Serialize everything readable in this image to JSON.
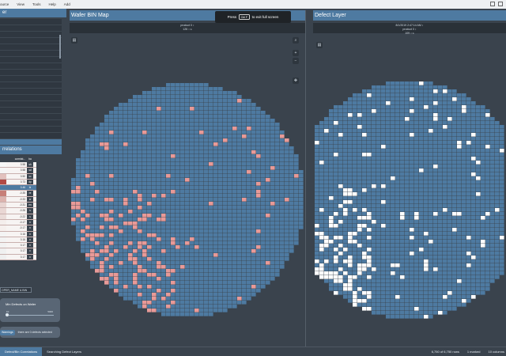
{
  "menubar": {
    "items": [
      "ource",
      "View",
      "Tools",
      "Help",
      "Add"
    ]
  },
  "left_panel": {
    "title_partial": "er",
    "param_rows": 20,
    "correlations_title_partial": "rrelations",
    "table": {
      "headers": [
        "",
        "correlat...",
        "ba"
      ],
      "rows": [
        {
          "value": "0.58",
          "bin": "sh",
          "color": "#f7f7f7"
        },
        {
          "value": "0.58",
          "bin": "sd",
          "color": "#f5f5f5"
        },
        {
          "value": "0.50",
          "bin": "sc",
          "color": "#e2c1bd"
        },
        {
          "value": "0.73",
          "bin": "dp",
          "color": "#b24a45"
        },
        {
          "value": "0.46",
          "bin": "bi",
          "color": "#4e7aa1",
          "selected": true
        },
        {
          "value": "-0.35",
          "bin": "re",
          "color": "#c77f78"
        },
        {
          "value": "-0.33",
          "bin": "w",
          "color": "#dcb3ae"
        },
        {
          "value": "-0.31",
          "bin": "en",
          "color": "#e8d4d1"
        },
        {
          "value": "-0.26",
          "bin": "s",
          "color": "#e9d7d4"
        },
        {
          "value": "-0.22",
          "bin": "s",
          "color": "#eadcd9"
        },
        {
          "value": "-0.17",
          "bin": "n",
          "color": "#f4eeec"
        },
        {
          "value": "-0.17",
          "bin": "n",
          "color": "#f6f0ee"
        },
        {
          "value": "0.16",
          "bin": "n",
          "color": "#f4f4f4"
        },
        {
          "value": "0.16",
          "bin": "n",
          "color": "#f3f3f3"
        },
        {
          "value": "0.17",
          "bin": "n",
          "color": "#f2f2f2"
        },
        {
          "value": "0.17",
          "bin": "c",
          "color": "#f0f0f0"
        },
        {
          "value": "0.17",
          "bin": "n",
          "color": "#efefef"
        }
      ]
    },
    "bin_filter_value": "OPER_NAME & BIN",
    "min_defects": {
      "label": "Min Defects on Wafer",
      "min": "10",
      "max": "5000",
      "level": 0.0
    },
    "warnings": {
      "button": "Warnings",
      "text": "there are 0 defects selected"
    }
  },
  "wbin_view": {
    "title": "Wafer BIN Map",
    "subbar_line1": "product 0 ↕",
    "subbar_line2": "126 ↕ ≤",
    "tools": [
      "search-icon",
      "zoom-in-icon",
      "zoom-out-icon",
      "pan-icon"
    ],
    "die_color": "#4e7aa1",
    "flag_color": "#e89a98",
    "grid_color": "#6d90b0"
  },
  "defect_view": {
    "title": "Defect Layer",
    "subbar_line1": "8/1/2019 2:47:14 AM ↕",
    "subbar_line2": "product 0 ↕",
    "subbar_line3": "109 ↕ ≤",
    "die_color": "#4e7aa1",
    "defect_color": "#ffffff"
  },
  "fullscreen_notice": {
    "press": "Press",
    "key": "Ctrl F",
    "rest": "to exit full screen"
  },
  "statusbar": {
    "tabs": [
      "Defect/Bin Correlations",
      "Searching Defect Layers"
    ],
    "rows_info": "6,750 of 6,750 rows",
    "marked": "1 marked",
    "columns": "10 columns"
  },
  "colors": {
    "accent": "#4e7aa1",
    "background": "#3a434d",
    "panel_dark": "#2f3740"
  }
}
